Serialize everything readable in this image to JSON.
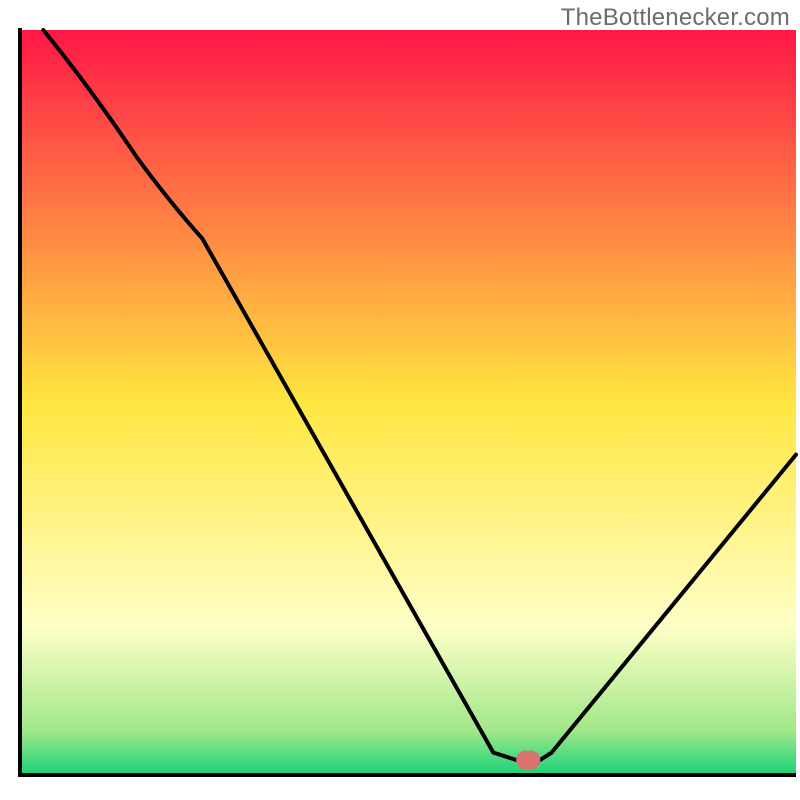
{
  "watermark": "TheBottlenecker.com",
  "colors": {
    "grad_top": "#ff1747",
    "grad_mid": "#ffe640",
    "grad_pale": "#ffffc7",
    "grad_green1": "#a2e88a",
    "grad_green2": "#19d17a",
    "axis": "#000000",
    "curve": "#000000",
    "marker_fill": "#d8736f",
    "marker_stroke": "#d8736f"
  },
  "chart_data": {
    "type": "line",
    "title": "",
    "xlabel": "",
    "ylabel": "",
    "xlim": [
      0,
      100
    ],
    "ylim": [
      0,
      100
    ],
    "x": [
      3,
      15,
      23.5,
      61,
      64,
      67,
      68.5,
      100
    ],
    "values": [
      100,
      83,
      72,
      3,
      2,
      2,
      3,
      43
    ],
    "marker": {
      "x_range": [
        64,
        67
      ],
      "y": 2
    },
    "notes": "V-shaped curve; trough near x≈65 at y≈2; right arm rises approximately linearly to ≈43 at x=100; left arm has gentle knee near x≈23.5."
  }
}
